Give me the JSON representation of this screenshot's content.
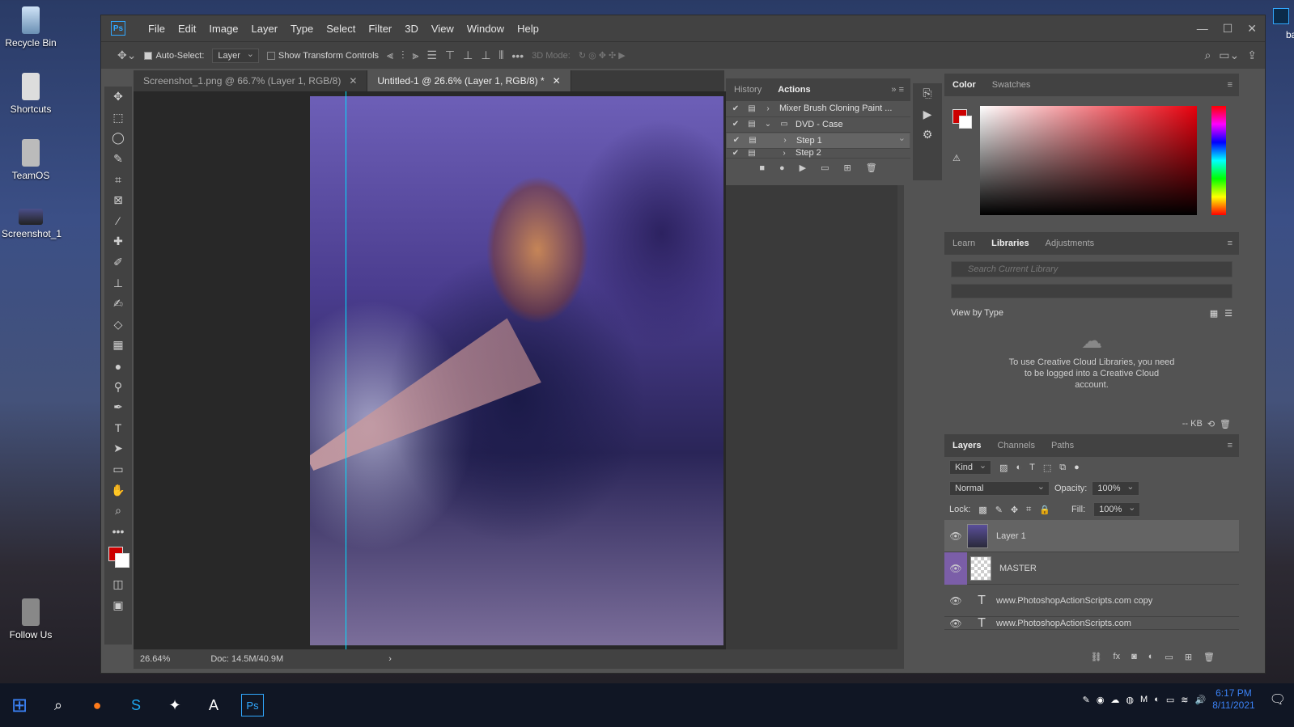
{
  "desktop": {
    "icons": [
      {
        "label": "Recycle Bin"
      },
      {
        "label": "Shortcuts"
      },
      {
        "label": "TeamOS"
      },
      {
        "label": "Screenshot_1"
      },
      {
        "label": "Follow Us"
      }
    ],
    "right_label": "ba"
  },
  "app": {
    "logo": "Ps",
    "menu": [
      "File",
      "Edit",
      "Image",
      "Layer",
      "Type",
      "Select",
      "Filter",
      "3D",
      "View",
      "Window",
      "Help"
    ]
  },
  "options": {
    "auto_select_label": "Auto-Select:",
    "auto_select_value": "Layer",
    "transform_label": "Show Transform Controls",
    "mode3d_label": "3D Mode:"
  },
  "tabs": [
    {
      "label": "Screenshot_1.png @ 66.7% (Layer 1, RGB/8)"
    },
    {
      "label": "Untitled-1 @ 26.6% (Layer 1, RGB/8) *"
    }
  ],
  "status": {
    "zoom": "26.64%",
    "doc": "Doc: 14.5M/40.9M"
  },
  "history_panel": {
    "tabs": [
      "History",
      "Actions"
    ],
    "rows": [
      {
        "label": "Mixer Brush Cloning Paint ..."
      },
      {
        "label": "DVD - Case"
      },
      {
        "label": "Step 1"
      },
      {
        "label": "Step 2"
      }
    ]
  },
  "color_panel": {
    "tabs": [
      "Color",
      "Swatches"
    ],
    "fg_color": "#cc0000",
    "bg_color": "#ffffff"
  },
  "libraries": {
    "tabs": [
      "Learn",
      "Libraries",
      "Adjustments"
    ],
    "search_placeholder": "Search Current Library",
    "view_by": "View by Type",
    "message": "To use Creative Cloud Libraries, you need to be logged into a Creative Cloud account.",
    "kb": "-- KB"
  },
  "layers": {
    "tabs": [
      "Layers",
      "Channels",
      "Paths"
    ],
    "kind": "Kind",
    "blend": "Normal",
    "opacity_label": "Opacity:",
    "opacity": "100%",
    "lock_label": "Lock:",
    "fill_label": "Fill:",
    "fill": "100%",
    "rows": [
      {
        "name": "Layer 1"
      },
      {
        "name": "MASTER"
      },
      {
        "name": "www.PhotoshopActionScripts.com copy"
      },
      {
        "name": "www.PhotoshopActionScripts.com"
      }
    ]
  },
  "taskbar": {
    "time": "6:17 PM",
    "date": "8/11/2021"
  }
}
